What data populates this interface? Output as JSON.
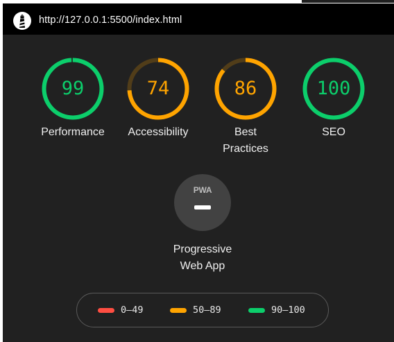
{
  "header": {
    "url": "http://127.0.0.1:5500/index.html",
    "logo_icon": "lighthouse-icon"
  },
  "gauges": [
    {
      "id": "performance",
      "score": "99",
      "label": "Performance",
      "fraction": 0.99,
      "color": "#0cce6b"
    },
    {
      "id": "accessibility",
      "score": "74",
      "label": "Accessibility",
      "fraction": 0.74,
      "color": "#ffa400"
    },
    {
      "id": "best-practices",
      "score": "86",
      "label": "Best Practices",
      "fraction": 0.86,
      "color": "#ffa400"
    },
    {
      "id": "seo",
      "score": "100",
      "label": "SEO",
      "fraction": 1.0,
      "color": "#0cce6b"
    }
  ],
  "pwa": {
    "badge_text": "PWA",
    "label": "Progressive Web App"
  },
  "legend": [
    {
      "range": "0–49",
      "color": "#ff4e42"
    },
    {
      "range": "50–89",
      "color": "#ffa400"
    },
    {
      "range": "90–100",
      "color": "#0cce6b"
    }
  ],
  "colors": {
    "pass": "#0cce6b",
    "average": "#ffa400",
    "fail": "#ff4e42",
    "background": "#212121",
    "header": "#000000"
  }
}
